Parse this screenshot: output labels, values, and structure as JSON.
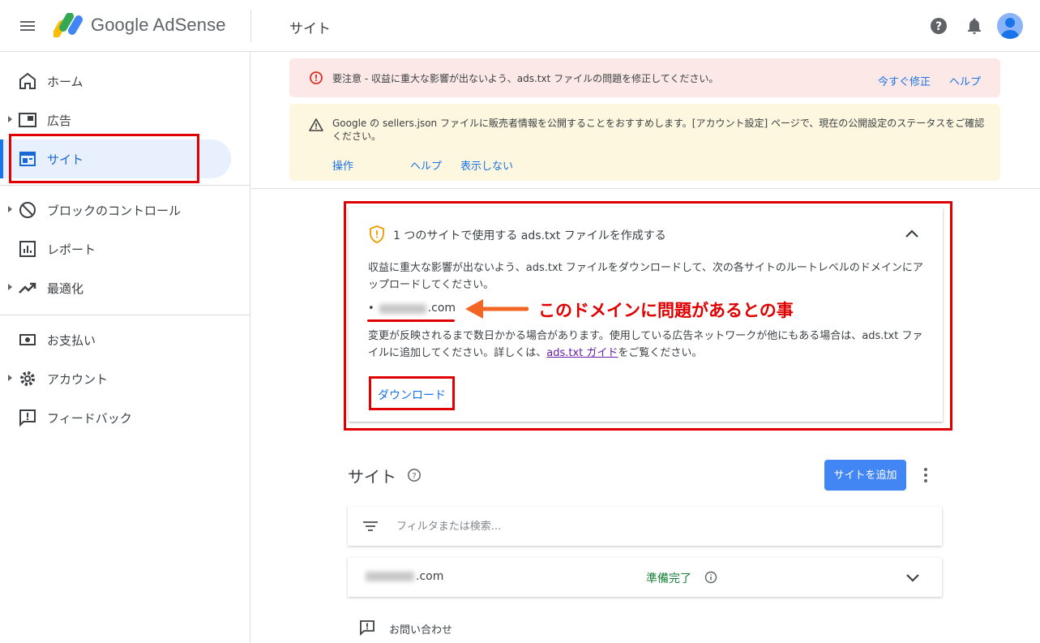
{
  "app": {
    "logo_text": "Google AdSense",
    "page_title": "サイト"
  },
  "sidebar": {
    "items": [
      {
        "label": "ホーム",
        "icon": "home-icon"
      },
      {
        "label": "広告",
        "icon": "ads-icon"
      },
      {
        "label": "サイト",
        "icon": "sites-icon",
        "active": true
      },
      {
        "label": "ブロックのコントロール",
        "icon": "block-icon"
      },
      {
        "label": "レポート",
        "icon": "report-icon"
      },
      {
        "label": "最適化",
        "icon": "trending-icon"
      },
      {
        "label": "お支払い",
        "icon": "payments-icon"
      },
      {
        "label": "アカウント",
        "icon": "settings-icon"
      },
      {
        "label": "フィードバック",
        "icon": "feedback-icon"
      }
    ]
  },
  "alerts": {
    "red": {
      "text": "要注意 - 収益に重大な影響が出ないよう、ads.txt ファイルの問題を修正してください。",
      "fix_link": "今すぐ修正",
      "help_link": "ヘルプ"
    },
    "yellow": {
      "text": "Google の sellers.json ファイルに販売者情報を公開することをおすすめします。[アカウント設定] ページで、現在の公開設定のステータスをご確認ください。",
      "action_link": "操作",
      "help_link": "ヘルプ",
      "dismiss_link": "表示しない"
    }
  },
  "card": {
    "title": "1 つのサイトで使用する ads.txt ファイルを作成する",
    "body1": "収益に重大な影響が出ないよう、ads.txt ファイルをダウンロードして、次の各サイトのルートレベルのドメインにアップロードしてください。",
    "domain_suffix": ".com",
    "body2_before": "変更が反映されるまで数日かかる場合があります。使用している広告ネットワークが他にもある場合は、ads.txt ファイルに追加してください。詳しくは、",
    "guide_link": "ads.txt ガイド",
    "body2_after": "をご覧ください。",
    "download": "ダウンロード"
  },
  "annotation": "このドメインに問題があるとの事",
  "sites": {
    "heading": "サイト",
    "add_button": "サイトを追加",
    "filter_placeholder": "フィルタまたは検索...",
    "rows": [
      {
        "domain_suffix": ".com",
        "status": "準備完了"
      }
    ],
    "contact": "お問い合わせ"
  },
  "colors": {
    "accent": "#1a73e8",
    "annotation_red": "#e00000",
    "ready_green": "#188038",
    "error_bg": "#fce8e6",
    "warning_bg": "#fef7e0"
  }
}
